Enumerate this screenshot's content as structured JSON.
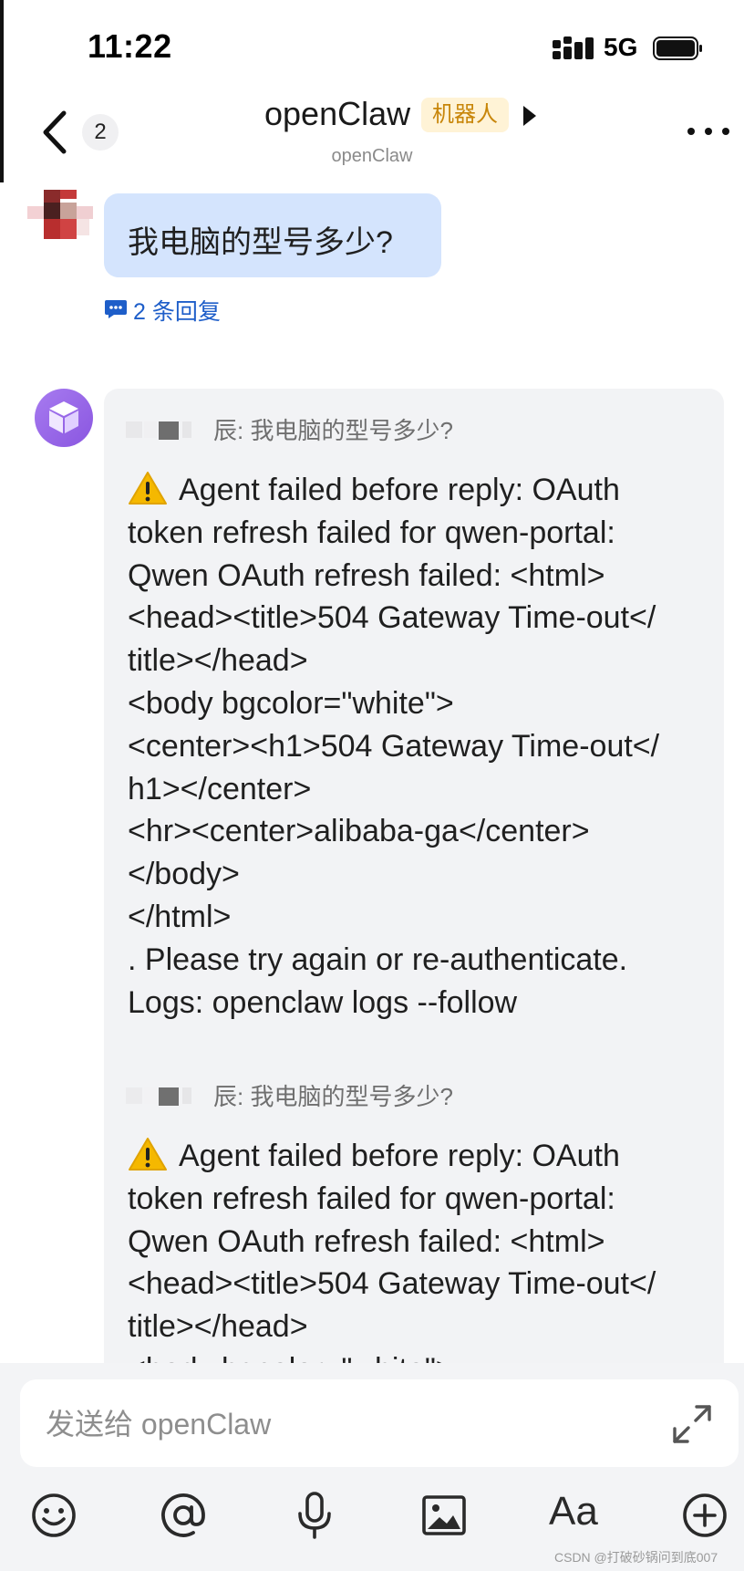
{
  "status_bar": {
    "time": "11:22",
    "network": "5G"
  },
  "nav": {
    "unread_count": "2",
    "title": "openClaw",
    "tag": "机器人",
    "subtitle": "openClaw"
  },
  "messages": {
    "user_message": "我电脑的型号多少?",
    "reply_count_label": "2 条回复",
    "bot_replies": [
      {
        "quote": "辰: 我电脑的型号多少?",
        "lines": [
          "Agent failed before reply: OAuth",
          "token refresh failed for qwen-portal:",
          "Qwen OAuth refresh failed: <html>",
          "<head><title>504 Gateway Time-out</",
          "title></head>",
          "<body bgcolor=\"white\">",
          "<center><h1>504 Gateway Time-out</",
          "h1></center>",
          "<hr><center>alibaba-ga</center>",
          "</body>",
          "</html>",
          ". Please try again or re-authenticate.",
          "Logs: openclaw logs --follow"
        ]
      },
      {
        "quote": "辰: 我电脑的型号多少?",
        "lines": [
          "Agent failed before reply: OAuth",
          "token refresh failed for qwen-portal:",
          "Qwen OAuth refresh failed: <html>",
          "<head><title>504 Gateway Time-out</",
          "title></head>",
          "<body bgcolor=\"white\">"
        ]
      }
    ]
  },
  "input": {
    "placeholder": "发送给 openClaw"
  },
  "toolbar": {
    "items": [
      "emoji-icon",
      "at-icon",
      "microphone-icon",
      "image-icon",
      "text-format-icon",
      "plus-icon"
    ],
    "format_label": "Aa"
  },
  "watermark": "CSDN @打破砂锅问到底007",
  "colors": {
    "user_bubble": "#d4e4fd",
    "bot_bubble": "#f2f3f5",
    "link": "#1e5ec9",
    "bot_tag_bg": "#fff3d6",
    "bot_tag_text": "#c8860a",
    "bot_avatar": "#9b6bea"
  }
}
